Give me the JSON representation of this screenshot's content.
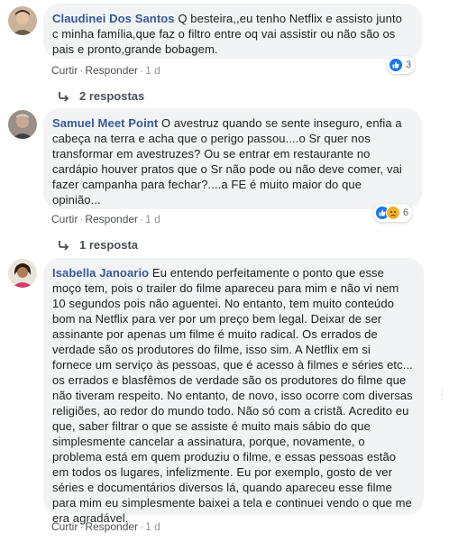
{
  "comments": [
    {
      "author": "Claudinei Dos Santos",
      "text": "Q besteira,,eu tenho Netflix e assisto junto c minha família,que faz o filtro entre oq vai assistir ou não são os pais e pronto,grande bobagem.",
      "actions": {
        "like": "Curtir",
        "reply": "Responder",
        "time": "1 d"
      },
      "reaction_count": "3",
      "replies_label": "2 respostas"
    },
    {
      "author": "Samuel Meet Point",
      "text": "O avestruz quando se sente inseguro, enfia a cabeça na terra e acha que o perigo passou....o Sr quer nos transformar em avestruzes? Ou se entrar em restaurante no cardápio houver pratos que o Sr não pode ou não deve comer, vai fazer campanha para fechar?....a FE é muito maior do que opinião...",
      "actions": {
        "like": "Curtir",
        "reply": "Responder",
        "time": "1 d"
      },
      "reaction_count": "6",
      "replies_label": "1 resposta"
    },
    {
      "author": "Isabella Janoario",
      "text": "Eu entendo perfeitamente o ponto que esse moço tem, pois o trailer do filme apareceu para mim e não vi nem 10 segundos pois não aguentei. No entanto, tem muito conteúdo bom na Netflix para ver por um preço bem legal. Deixar de ser assinante por apenas um filme é muito radical. Os errados de verdade são os produtores do filme, isso sim. A Netflix em si fornece um serviço às pessoas, que é acesso à filmes e séries etc... os errados e blasfêmos de verdade são os produtores do filme que não tiveram respeito. No entanto, de novo, isso ocorre com diversas religiões, ao redor do mundo todo. Não só com a cristã. Acredito eu que, saber filtrar o que se assiste é muito mais sábio do que simplesmente cancelar a assinatura, porque, novamente, o problema está em quem produziu o filme, e essas pessoas estão em todos os lugares, infelizmente. Eu por exemplo, gosto de ver séries e documentários diversos lá, quando apareceu esse filme para mim eu simplesmente baixei a tela e continuei vendo o que me era agradável.",
      "actions": {
        "like": "Curtir",
        "reply": "Responder",
        "time": "1 d"
      }
    }
  ],
  "icons": {
    "like": "like-reaction-icon",
    "sad": "sad-reaction-icon",
    "reply_arrow": "reply-arrow-icon"
  },
  "colors": {
    "author": "#385898",
    "bubble": "#f2f3f5",
    "like_blue": "#1877f2",
    "sad_yellow": "#f7b125",
    "meta_gray": "#90949c"
  }
}
